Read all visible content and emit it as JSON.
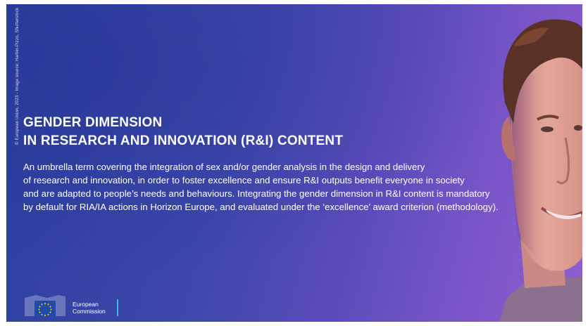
{
  "credit": "© European Union, 2023 - Image source: Harbin-Pizzo, Shutterstock",
  "headline": {
    "line1": "GENDER DIMENSION",
    "line2": "IN RESEARCH AND INNOVATION (R&I) CONTENT"
  },
  "description": {
    "lines": [
      "An umbrella term covering the integration of sex and/or gender analysis in the design and delivery",
      "of research and innovation, in order to foster excellence and ensure R&I outputs benefit everyone in society",
      "and are adapted to people’s needs and behaviours. Integrating the gender dimension in R&I content is mandatory",
      "by default for RIA/IA actions in Horizon Europe, and evaluated under the ‘excellence’ award criterion (methodology)."
    ]
  },
  "logo": {
    "line1": "European",
    "line2": "Commission",
    "icon": "eu-flag-icon"
  },
  "colors": {
    "background_start": "#2c3f9e",
    "background_end": "#8e5fcf",
    "text": "#ffffff",
    "logo_accent": "#3fb8e8",
    "eu_flag_blue": "#1f4aa8",
    "eu_stars": "#ffdd00"
  },
  "portrait": "young-man-smiling-photo"
}
